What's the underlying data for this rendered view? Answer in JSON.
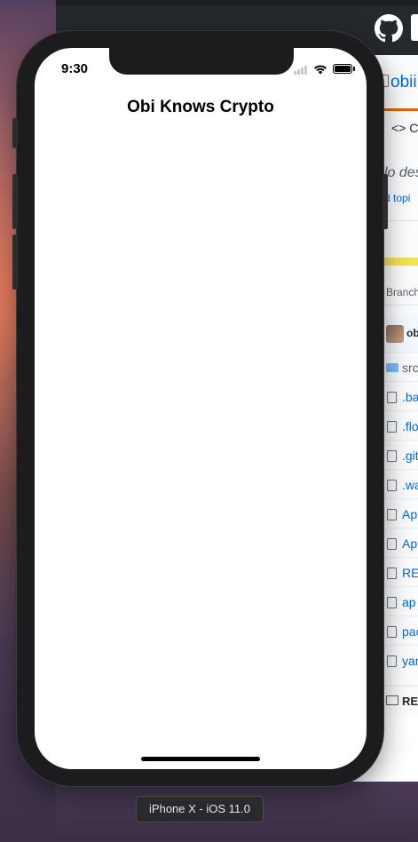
{
  "simulator": {
    "device_label": "iPhone X - iOS 11.0"
  },
  "status_bar": {
    "time": "9:30",
    "signal_icon": "cellular-signal-icon",
    "wifi_icon": "wifi-icon",
    "battery_icon": "battery-icon",
    "battery_level": 1.0
  },
  "app": {
    "nav_title": "Obi Knows Crypto"
  },
  "browser": {
    "logo_icon": "github-icon",
    "repo_title": "obii",
    "tab_code": "Co",
    "description": "lo des",
    "topics_link": "d topi",
    "branch_label": "Branch",
    "commit_user": "ob",
    "files": [
      {
        "name": "src",
        "kind": "folder"
      },
      {
        "name": ".ba",
        "kind": "file"
      },
      {
        "name": ".flo",
        "kind": "file"
      },
      {
        "name": ".git",
        "kind": "file"
      },
      {
        "name": ".wa",
        "kind": "file"
      },
      {
        "name": "Ap",
        "kind": "file"
      },
      {
        "name": "Ap",
        "kind": "file"
      },
      {
        "name": "RE",
        "kind": "file"
      },
      {
        "name": "ap",
        "kind": "file"
      },
      {
        "name": "pac",
        "kind": "file"
      },
      {
        "name": "yar",
        "kind": "file"
      }
    ],
    "readme_label": "RE"
  },
  "colors": {
    "github_header": "#24292e",
    "link": "#0366d6",
    "accent_orange": "#e36209",
    "language_bar": "#f1e05a"
  }
}
